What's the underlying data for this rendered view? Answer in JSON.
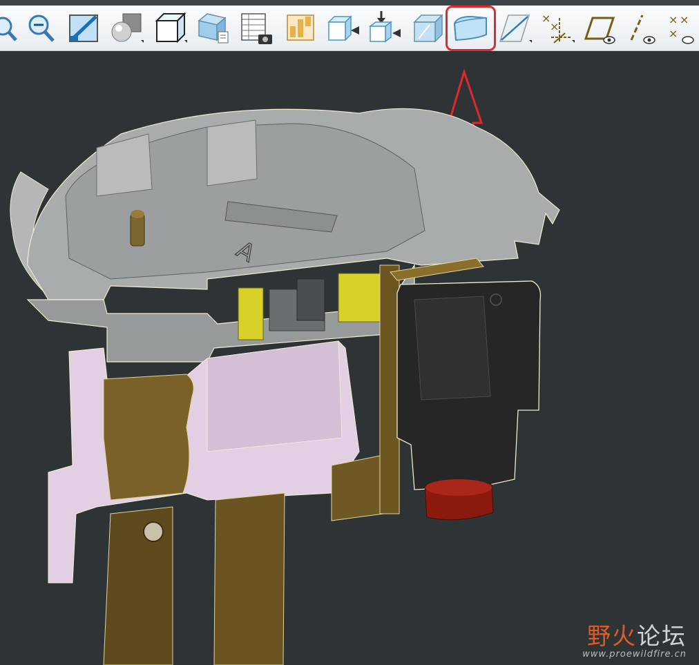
{
  "toolbar": {
    "buttons": [
      {
        "icon": "zoom-in-icon"
      },
      {
        "icon": "zoom-out-icon"
      },
      {
        "icon": "repaint-icon"
      },
      {
        "icon": "shading-icon"
      },
      {
        "icon": "named-view-icon"
      },
      {
        "icon": "view-manager-icon"
      },
      {
        "icon": "appearance-table-icon"
      },
      {
        "icon": "layers-icon"
      },
      {
        "icon": "extrude-left-icon"
      },
      {
        "icon": "move-component-icon"
      },
      {
        "icon": "transparent-box-icon"
      },
      {
        "icon": "cross-section-icon",
        "highlighted": true
      },
      {
        "icon": "datum-plane-icon"
      },
      {
        "icon": "datum-axis-csys-icon"
      },
      {
        "icon": "plane-display-icon"
      },
      {
        "icon": "axis-display-icon"
      },
      {
        "icon": "point-display-icon"
      }
    ]
  },
  "annotation": {
    "color": "#e0282d"
  },
  "watermark": {
    "title_accent": "野火",
    "title_rest": "论坛",
    "url": "www.proewildfire.cn"
  },
  "colors": {
    "background": "#2e3436",
    "housing_gray": "#a9acad",
    "pink_part": "#e3cfe3",
    "brass": "#7a6128",
    "yellow_contact": "#d8d12a",
    "black_part": "#262626",
    "red_cap": "#8a1a0e"
  }
}
